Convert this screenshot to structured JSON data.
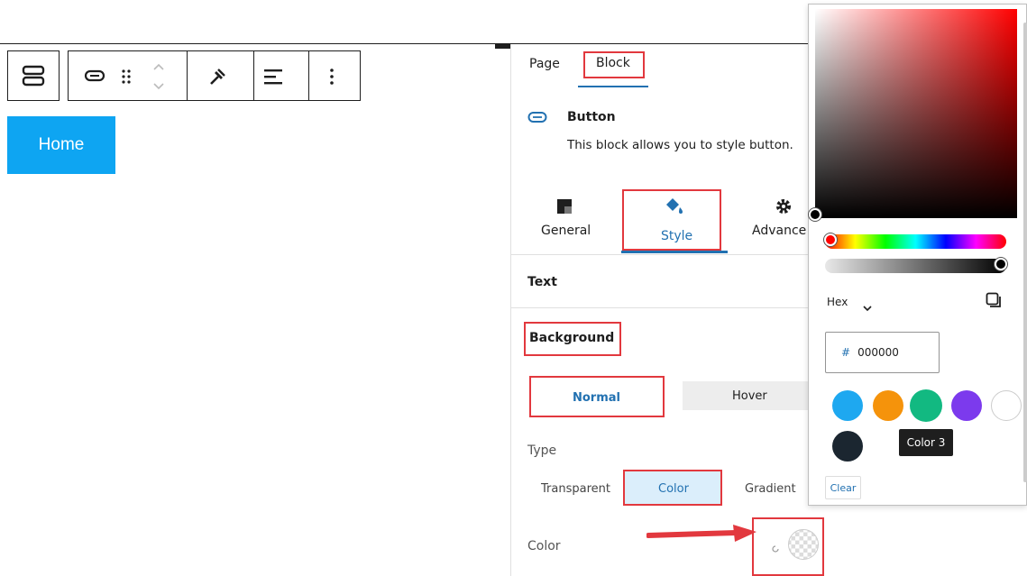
{
  "canvas": {
    "home_button_label": "Home"
  },
  "toolbar": {
    "icons": [
      "block-type-icon",
      "button-icon",
      "drag-handle-icon",
      "move-arrows-icon",
      "link-icon",
      "align-icon",
      "more-options-icon"
    ]
  },
  "sidebar": {
    "tabs": [
      "Page",
      "Block"
    ],
    "block": {
      "name": "Button",
      "description": "This block allows you to style button."
    },
    "inner_tabs": [
      "General",
      "Style",
      "Advance"
    ],
    "sections": {
      "text": "Text",
      "background": "Background"
    },
    "state_tabs": [
      "Normal",
      "Hover"
    ],
    "type_label": "Type",
    "type_options": [
      "Transparent",
      "Color",
      "Gradient"
    ],
    "color_label": "Color"
  },
  "picker": {
    "format_label": "Hex",
    "hex_prefix": "#",
    "hex_value": "000000",
    "swatch_colors": [
      "#1ea8f0",
      "#f5930b",
      "#12b981",
      "#7c3aed",
      "#ffffff",
      "#1b2630"
    ],
    "tooltip": "Color 3",
    "clear_label": "Clear"
  },
  "colors": {
    "accent": "#0ea5f2",
    "highlight": "#e2383e",
    "link": "#2271b1"
  }
}
